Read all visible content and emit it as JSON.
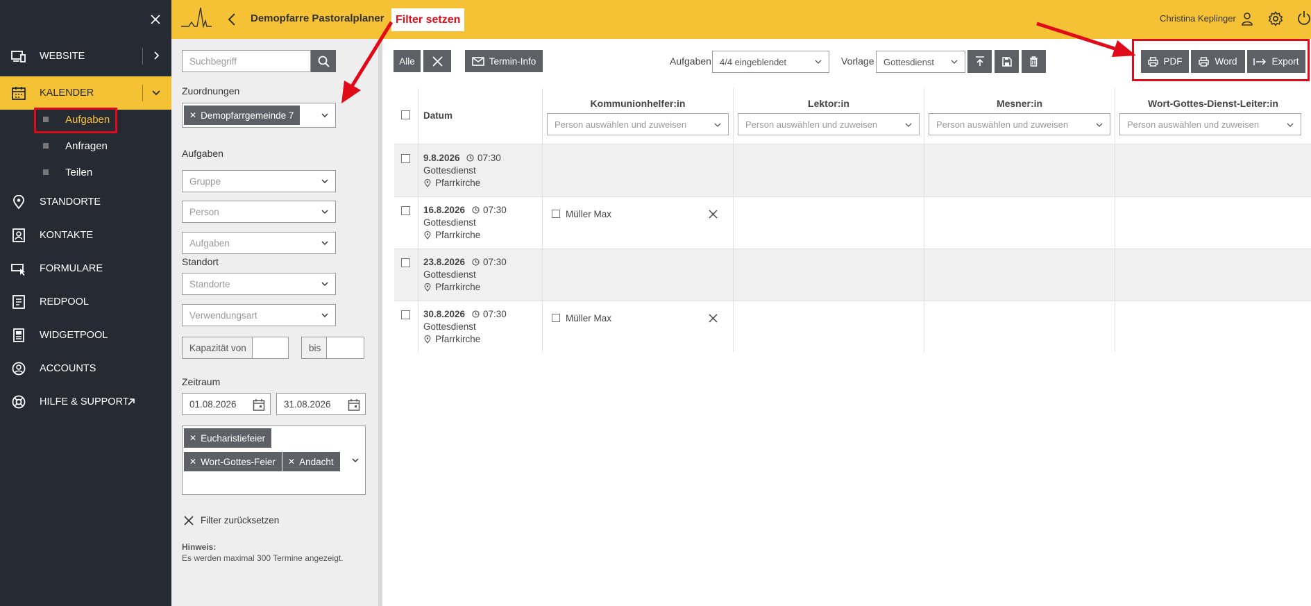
{
  "sidebar": {
    "items": [
      {
        "label": "WEBSITE"
      },
      {
        "label": "KALENDER"
      },
      {
        "label": "STANDORTE"
      },
      {
        "label": "KONTAKTE"
      },
      {
        "label": "FORMULARE"
      },
      {
        "label": "REDPOOL"
      },
      {
        "label": "WIDGETPOOL"
      },
      {
        "label": "ACCOUNTS"
      },
      {
        "label": "HILFE & SUPPORT"
      }
    ],
    "sub_items": [
      {
        "label": "Aufgaben"
      },
      {
        "label": "Anfragen"
      },
      {
        "label": "Teilen"
      }
    ]
  },
  "header": {
    "title": "Demopfarre Pastoralplaner",
    "annotation": "Filter setzen",
    "user": "Christina Keplinger"
  },
  "filter": {
    "search_placeholder": "Suchbegriff",
    "zuordnungen_label": "Zuordnungen",
    "zuordnung_chip": "Demopfarrgemeinde 7",
    "aufgaben_label": "Aufgaben",
    "gruppe": "Gruppe",
    "person": "Person",
    "aufgaben": "Aufgaben",
    "standort_label": "Standort",
    "standorte": "Standorte",
    "verwendungsart": "Verwendungsart",
    "kapazitaet_von": "Kapazität von",
    "bis": "bis",
    "zeitraum_label": "Zeitraum",
    "date_from": "01.08.2026",
    "date_to": "31.08.2026",
    "event_types": [
      "Eucharistiefeier",
      "Wort-Gottes-Feier",
      "Andacht"
    ],
    "reset_label": "Filter zurücksetzen",
    "hint_title": "Hinweis:",
    "hint_text": "Es werden maximal 300 Termine angezeigt."
  },
  "toolbar": {
    "alle": "Alle",
    "termin_info": "Termin-Info",
    "aufgaben_label": "Aufgaben",
    "aufgaben_value": "4/4 eingeblendet",
    "vorlage_label": "Vorlage",
    "vorlage_value": "Gottesdienst",
    "pdf": "PDF",
    "word": "Word",
    "export": "Export"
  },
  "table": {
    "date_header": "Datum",
    "columns": [
      {
        "name": "Kommunionhelfer:in"
      },
      {
        "name": "Lektor:in"
      },
      {
        "name": "Mesner:in"
      },
      {
        "name": "Wort-Gottes-Dienst-Leiter:in"
      }
    ],
    "person_placeholder": "Person auswählen und zuweisen",
    "rows": [
      {
        "date": "9.8.2026",
        "time": "07:30",
        "type": "Gottesdienst",
        "place": "Pfarrkirche",
        "assigned": ""
      },
      {
        "date": "16.8.2026",
        "time": "07:30",
        "type": "Gottesdienst",
        "place": "Pfarrkirche",
        "assigned": "Müller Max"
      },
      {
        "date": "23.8.2026",
        "time": "07:30",
        "type": "Gottesdienst",
        "place": "Pfarrkirche",
        "assigned": ""
      },
      {
        "date": "30.8.2026",
        "time": "07:30",
        "type": "Gottesdienst",
        "place": "Pfarrkirche",
        "assigned": "Müller Max"
      }
    ]
  },
  "colors": {
    "accent": "#f6c235",
    "sidebar": "#252a33",
    "annotation": "#e00a18"
  }
}
